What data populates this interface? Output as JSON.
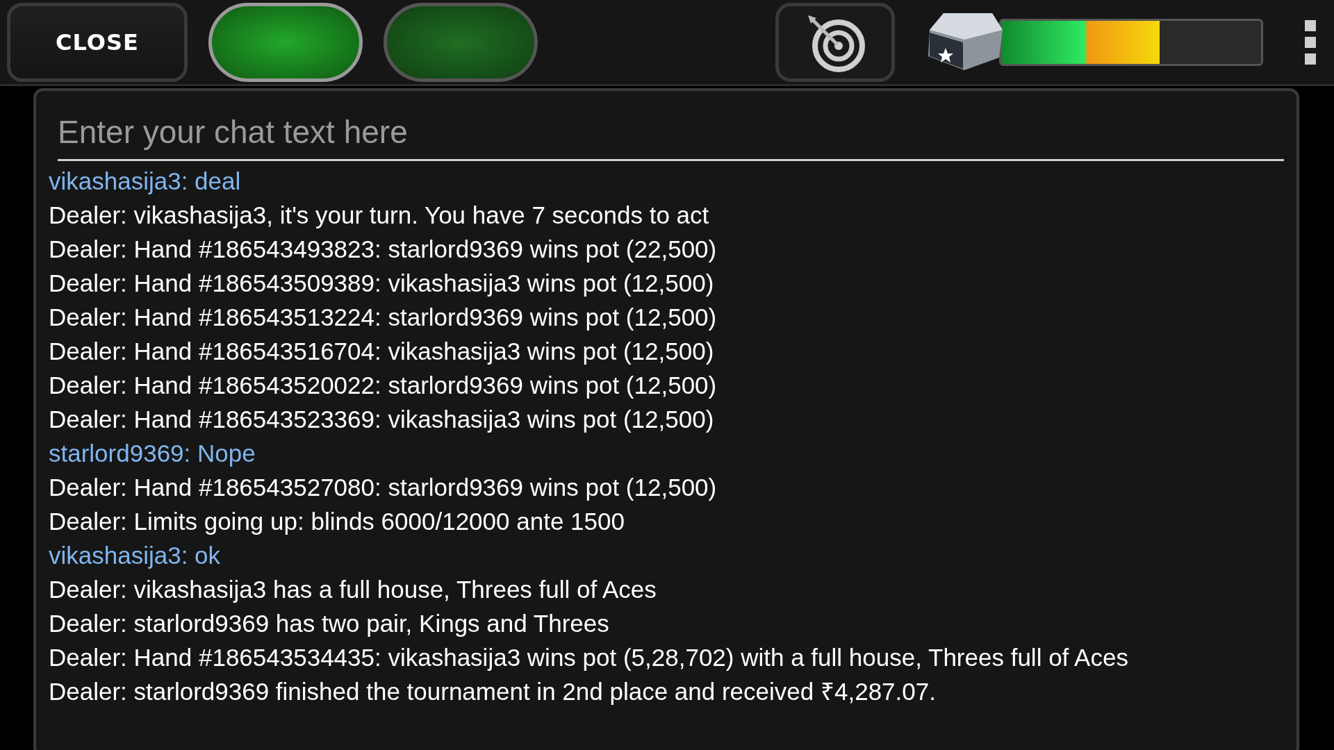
{
  "toolbar": {
    "close_button": "CLOSE",
    "pill_buttons": [
      {
        "selected": true
      },
      {
        "selected": false
      }
    ],
    "reward_progress": {
      "level": 0.61
    }
  },
  "chat": {
    "input": {
      "placeholder": "Enter your chat text here"
    },
    "messages": [
      {
        "kind": "player",
        "text": "vikashasija3: deal"
      },
      {
        "kind": "dealer",
        "text": "Dealer: vikashasija3, it's your turn. You have 7 seconds to act"
      },
      {
        "kind": "dealer",
        "text": "Dealer: Hand #186543493823: starlord9369 wins pot (22,500)"
      },
      {
        "kind": "dealer",
        "text": "Dealer: Hand #186543509389: vikashasija3 wins pot (12,500)"
      },
      {
        "kind": "dealer",
        "text": "Dealer: Hand #186543513224: starlord9369 wins pot (12,500)"
      },
      {
        "kind": "dealer",
        "text": "Dealer: Hand #186543516704: vikashasija3 wins pot (12,500)"
      },
      {
        "kind": "dealer",
        "text": "Dealer: Hand #186543520022: starlord9369 wins pot (12,500)"
      },
      {
        "kind": "dealer",
        "text": "Dealer: Hand #186543523369: vikashasija3 wins pot (12,500)"
      },
      {
        "kind": "player",
        "text": "starlord9369: Nope"
      },
      {
        "kind": "dealer",
        "text": "Dealer: Hand #186543527080: starlord9369 wins pot (12,500)"
      },
      {
        "kind": "dealer",
        "text": "Dealer: Limits going up: blinds 6000/12000 ante 1500"
      },
      {
        "kind": "player",
        "text": "vikashasija3: ok"
      },
      {
        "kind": "dealer",
        "text": "Dealer: vikashasija3 has a full house, Threes full of Aces"
      },
      {
        "kind": "dealer",
        "text": "Dealer: starlord9369 has two pair, Kings and Threes"
      },
      {
        "kind": "dealer",
        "text": "Dealer: Hand #186543534435: vikashasija3 wins pot (5,28,702) with a full house, Threes full of Aces"
      },
      {
        "kind": "dealer",
        "text": "Dealer: starlord9369 finished the tournament in 2nd place and received ₹4,287.07."
      }
    ]
  }
}
